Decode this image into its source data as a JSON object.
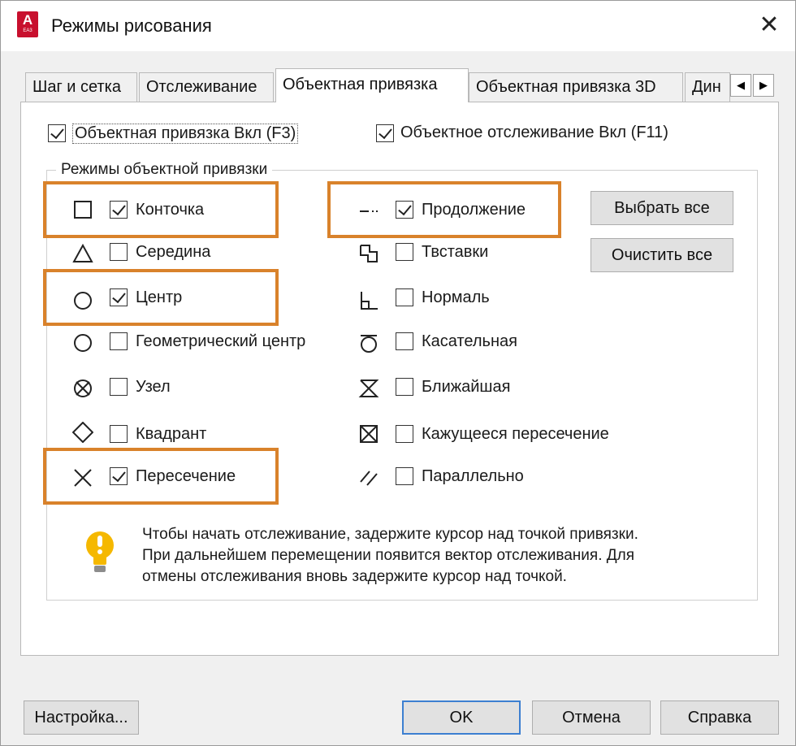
{
  "window": {
    "title": "Режимы рисования",
    "app_icon_letter": "A",
    "app_icon_sub": "EA3"
  },
  "tabs": [
    {
      "label": "Шаг и сетка",
      "active": false
    },
    {
      "label": "Отслеживание",
      "active": false
    },
    {
      "label": "Объектная привязка",
      "active": true
    },
    {
      "label": "Объектная привязка 3D",
      "active": false
    },
    {
      "label": "Дин",
      "active": false
    }
  ],
  "tab_scroll": {
    "left": "◀",
    "right": "▶"
  },
  "toggles": {
    "osnap_on": {
      "label": "Объектная привязка Вкл (F3)",
      "checked": true
    },
    "otrack_on": {
      "label": "Объектное отслеживание Вкл (F11)",
      "checked": true
    }
  },
  "group_title": "Режимы объектной привязки",
  "snap_modes_left": [
    {
      "label": "Конточка",
      "checked": true,
      "icon": "square-icon"
    },
    {
      "label": "Середина",
      "checked": false,
      "icon": "triangle-icon"
    },
    {
      "label": "Центр",
      "checked": true,
      "icon": "circle-icon"
    },
    {
      "label": "Геометрический центр",
      "checked": false,
      "icon": "circle-icon"
    },
    {
      "label": "Узел",
      "checked": false,
      "icon": "node-icon"
    },
    {
      "label": "Квадрант",
      "checked": false,
      "icon": "diamond-icon"
    },
    {
      "label": "Пересечение",
      "checked": true,
      "icon": "x-icon"
    }
  ],
  "snap_modes_right": [
    {
      "label": "Продолжение",
      "checked": true,
      "icon": "extension-icon"
    },
    {
      "label": "Твставки",
      "checked": false,
      "icon": "insert-icon"
    },
    {
      "label": "Нормаль",
      "checked": false,
      "icon": "perpendicular-icon"
    },
    {
      "label": "Касательная",
      "checked": false,
      "icon": "tangent-icon"
    },
    {
      "label": "Ближайшая",
      "checked": false,
      "icon": "hourglass-icon"
    },
    {
      "label": "Кажущееся пересечение",
      "checked": false,
      "icon": "boxed-x-icon"
    },
    {
      "label": "Параллельно",
      "checked": false,
      "icon": "parallel-icon"
    }
  ],
  "buttons": {
    "select_all": "Выбрать все",
    "clear_all": "Очистить все",
    "options": "Настройка...",
    "ok": "OK",
    "cancel": "Отмена",
    "help": "Справка"
  },
  "hint_lines": [
    "Чтобы начать отслеживание, задержите курсор над точкой привязки.",
    "При дальнейшем перемещении появится вектор отслеживания. Для",
    "отмены отслеживания вновь задержите курсор над точкой."
  ],
  "highlight_color": "#d9822b"
}
